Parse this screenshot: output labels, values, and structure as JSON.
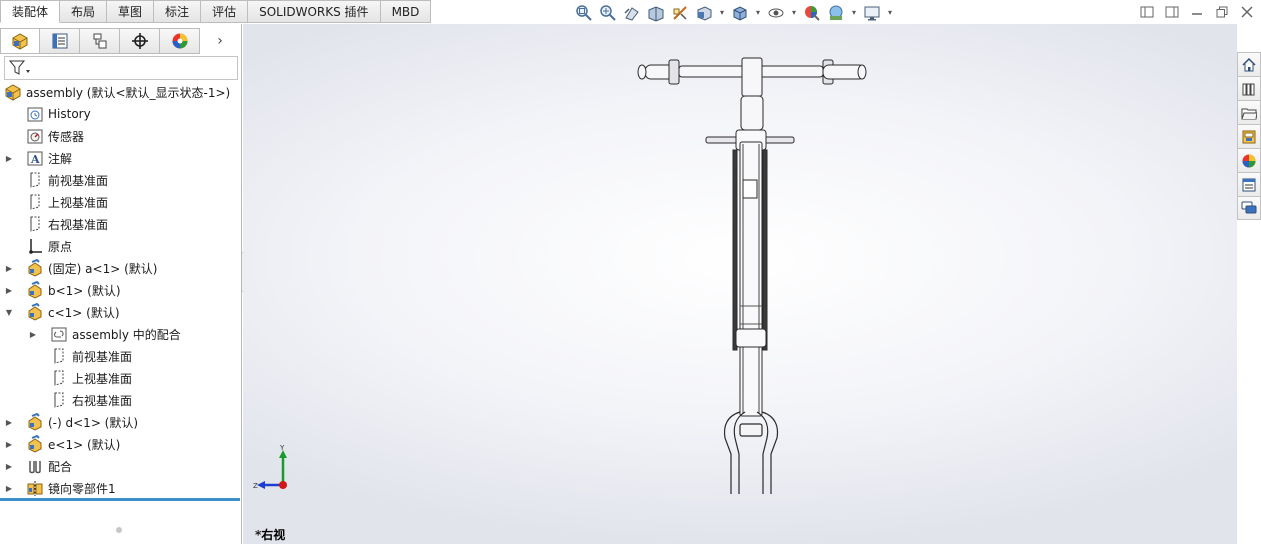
{
  "tabs": [
    "装配体",
    "布局",
    "草图",
    "标注",
    "评估",
    "SOLIDWORKS 插件",
    "MBD"
  ],
  "toolbar_icons": [
    "zoom-to-fit-icon",
    "zoom-to-area-icon",
    "previous-view-icon",
    "section-view-icon",
    "dynamic-annotation-icon",
    "view-orientation-icon",
    "display-style-icon",
    "hide-show-items-icon",
    "edit-appearance-icon",
    "apply-scene-icon",
    "view-settings-icon"
  ],
  "panel_tabs": [
    "feature-manager-icon",
    "property-manager-icon",
    "configuration-manager-icon",
    "dimxpert-icon",
    "display-manager-icon"
  ],
  "tree": [
    {
      "label": "assembly  (默认<默认_显示状态-1>)",
      "icon": "assembly-icon",
      "indent": 0,
      "arrow": ""
    },
    {
      "label": "History",
      "icon": "history-icon",
      "indent": 1,
      "arrow": ""
    },
    {
      "label": "传感器",
      "icon": "sensor-icon",
      "indent": 1,
      "arrow": ""
    },
    {
      "label": "注解",
      "icon": "annotation-icon",
      "indent": 1,
      "arrow": "▶"
    },
    {
      "label": "前视基准面",
      "icon": "plane-icon",
      "indent": 1,
      "arrow": ""
    },
    {
      "label": "上视基准面",
      "icon": "plane-icon",
      "indent": 1,
      "arrow": ""
    },
    {
      "label": "右视基准面",
      "icon": "plane-icon",
      "indent": 1,
      "arrow": ""
    },
    {
      "label": "原点",
      "icon": "origin-icon",
      "indent": 1,
      "arrow": ""
    },
    {
      "label": "(固定) a<1> (默认)",
      "icon": "part-icon",
      "indent": 1,
      "arrow": "▶"
    },
    {
      "label": "b<1> (默认)",
      "icon": "part-icon",
      "indent": 1,
      "arrow": "▶"
    },
    {
      "label": "c<1> (默认)",
      "icon": "part-icon",
      "indent": 1,
      "arrow": "▼"
    },
    {
      "label": "assembly 中的配合",
      "icon": "mates-folder-icon",
      "indent": 2,
      "arrow": "▶"
    },
    {
      "label": "前视基准面",
      "icon": "plane-icon",
      "indent": 2,
      "arrow": ""
    },
    {
      "label": "上视基准面",
      "icon": "plane-icon",
      "indent": 2,
      "arrow": ""
    },
    {
      "label": "右视基准面",
      "icon": "plane-icon",
      "indent": 2,
      "arrow": ""
    },
    {
      "label": "(-) d<1> (默认)",
      "icon": "part-icon",
      "indent": 1,
      "arrow": "▶"
    },
    {
      "label": "e<1> (默认)",
      "icon": "part-icon",
      "indent": 1,
      "arrow": "▶"
    },
    {
      "label": "配合",
      "icon": "mates-icon",
      "indent": 1,
      "arrow": "▶"
    },
    {
      "label": "镜向零部件1",
      "icon": "mirror-component-icon",
      "indent": 1,
      "arrow": "▶"
    }
  ],
  "viewport": {
    "view_label": "*右视",
    "triad": {
      "y_label": "Y",
      "z_label": "Z"
    }
  },
  "taskpane_tabs": [
    "home-icon",
    "design-library-icon",
    "file-explorer-icon",
    "view-palette-icon",
    "appearances-icon",
    "custom-properties-icon",
    "forum-icon"
  ],
  "colors": {
    "accent": "#3d8fc9",
    "triad_y": "#1a9a2a",
    "triad_z": "#1a3fd0",
    "triad_x": "#d01818"
  }
}
